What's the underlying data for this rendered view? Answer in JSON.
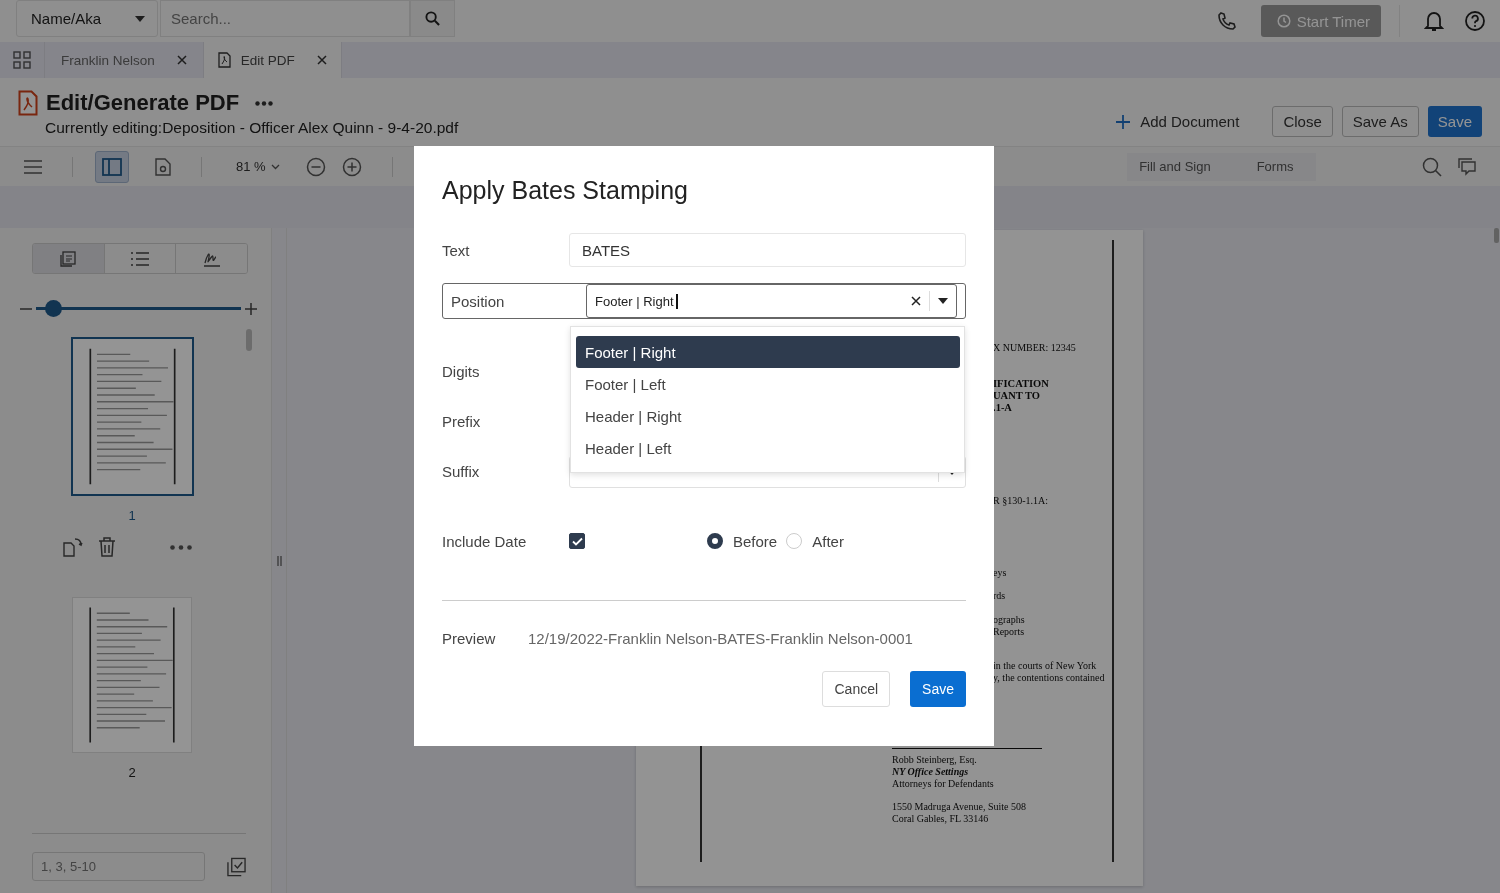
{
  "top_bar": {
    "search_scope": "Name/Aka",
    "search": {
      "placeholder": "Search..."
    },
    "timer_button": "Start Timer"
  },
  "tabs": [
    {
      "label": "Franklin Nelson",
      "selected": false
    },
    {
      "label": "Edit PDF",
      "selected": true
    }
  ],
  "header": {
    "title": "Edit/Generate PDF",
    "subtitle": "Currently editing:Deposition - Officer Alex Quinn - 9-4-20.pdf",
    "actions": [
      {
        "label": "Add Document",
        "kind": "link"
      },
      {
        "label": "Close",
        "kind": "outline"
      },
      {
        "label": "Save As",
        "kind": "outline"
      },
      {
        "label": "Save",
        "kind": "primary"
      }
    ]
  },
  "toolbar": {
    "sidebar_toggle": {
      "selected": true
    },
    "zoom": "81 %",
    "modes": [
      "Fill and Sign",
      "Forms"
    ]
  },
  "sidebar": {
    "view_tabs": [
      {
        "kind": "thumbnails",
        "selected": true
      },
      {
        "kind": "outline",
        "selected": false
      },
      {
        "kind": "signatures",
        "selected": false
      }
    ],
    "thumbnail_size": {
      "level": 0.05
    },
    "pages": [
      {
        "number": "1",
        "selected": true
      },
      {
        "number": "2",
        "selected": false
      }
    ],
    "page_range": {
      "placeholder": "1, 3, 5-10"
    }
  },
  "document": {
    "fragments": [
      {
        "text": "X NUMBER: 12345",
        "kind": "normal"
      },
      {
        "text": "IFICATION",
        "kind": "bold"
      },
      {
        "text": "UANT TO",
        "kind": "bold"
      },
      {
        "text": ".1-A",
        "kind": "bold"
      },
      {
        "text": "R §130-1.1A:",
        "kind": "normal"
      },
      {
        "text": "eys",
        "kind": "normal"
      },
      {
        "text": "rds",
        "kind": "normal"
      },
      {
        "text": "ographs",
        "kind": "normal"
      },
      {
        "text": "Reports",
        "kind": "normal"
      },
      {
        "text": "in the courts of New York",
        "kind": "normal"
      },
      {
        "text": "y, the contentions contained",
        "kind": "normal"
      }
    ],
    "signature": [
      {
        "text": "Robb Steinberg, Esq.",
        "kind": "normal"
      },
      {
        "text": "NY Office Settings",
        "kind": "italic"
      },
      {
        "text": "Attorneys for Defendants",
        "kind": "normal"
      },
      {
        "text": "1550 Madruga Avenue, Suite 508",
        "kind": "normal"
      },
      {
        "text": "Coral Gables, FL  33146",
        "kind": "normal"
      }
    ]
  },
  "dialog": {
    "title": "Apply Bates Stamping",
    "fields": [
      {
        "label": "Text",
        "kind": "text",
        "value": "BATES"
      },
      {
        "label": "Position",
        "kind": "combo",
        "value": "Footer | Right",
        "open": true,
        "options": [
          {
            "label": "Footer | Right",
            "selected": true
          },
          {
            "label": "Footer | Left",
            "selected": false
          },
          {
            "label": "Header | Right",
            "selected": false
          },
          {
            "label": "Header | Left",
            "selected": false
          }
        ]
      },
      {
        "label": "Digits",
        "kind": "covered"
      },
      {
        "label": "Prefix",
        "kind": "covered"
      },
      {
        "label": "Suffix",
        "kind": "select"
      }
    ],
    "include_date": {
      "label": "Include Date",
      "checked": true,
      "options": [
        {
          "label": "Before",
          "selected": true
        },
        {
          "label": "After",
          "selected": false
        }
      ]
    },
    "preview": {
      "label": "Preview",
      "value": "12/19/2022-Franklin Nelson-BATES-Franklin Nelson-0001"
    },
    "buttons": [
      {
        "label": "Cancel",
        "kind": "secondary"
      },
      {
        "label": "Save",
        "kind": "primary"
      }
    ]
  }
}
